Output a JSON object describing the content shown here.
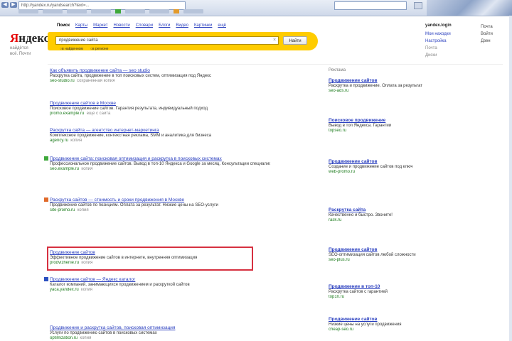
{
  "browser": {
    "url": "http://yandex.ru/yandsearch?text=...",
    "nav_back": "◀",
    "nav_fwd": "▶"
  },
  "logo": {
    "first_letter": "Я",
    "rest": "ндекс",
    "sub1": "найдётся",
    "sub2": "всё. Почти"
  },
  "tabs": [
    "Поиск",
    "Карты",
    "Маркет",
    "Новости",
    "Словари",
    "Блоги",
    "Видео",
    "Картинки",
    "ещё"
  ],
  "search": {
    "value": "продвижение сайта",
    "button_label": "Найти",
    "clear_icon": "×",
    "radios": [
      "в найденном",
      "в регионе"
    ]
  },
  "user": {
    "name": "yandex.login",
    "links": [
      "Мои находки",
      "Настройка",
      "Почта",
      "Диски"
    ]
  },
  "right_links": [
    "Почта",
    "Войти",
    "Дзен"
  ],
  "results": [
    {
      "title": "Как объявить продвижение сайта — seo studio",
      "snippet": "Раскрутка сайта, продвижение в топ поисковых систем, оптимизация под Яндекс",
      "url": "seo-studio.ru",
      "cache": "сохранённая копия"
    },
    {
      "title": "Продвижение сайтов в Москве",
      "snippet": "Поисковое продвижение сайтов. Гарантия результата, индивидуальный подход",
      "url": "promo.example.ru",
      "cache": "ещё с сайта"
    },
    {
      "title": "Раскрутка сайта — агентство интернет-маркетинга",
      "snippet": "Комплексное продвижение, контекстная реклама, SMM и аналитика для бизнеса",
      "url": "agency.ru",
      "cache": "копия"
    },
    {
      "title": "Продвижение сайта: поисковая оптимизация и раскрутка в поисковых системах",
      "snippet": "Профессиональное продвижение сайтов. Вывод в топ-10 Яндекса и Google за месяц. Консультации специалистов",
      "url": "seo.example.ru",
      "cache": "копия"
    },
    {
      "title": "Раскрутка сайтов — стоимость и сроки продвижения в Москве",
      "snippet": "Продвижение сайтов по позициям. Оплата за результат. Низкие цены на SEO-услуги",
      "url": "site-promo.ru",
      "cache": "копия"
    },
    {
      "title": "Продвижение сайтов",
      "snippet": "Эффективное продвижение сайтов в интернете, внутренняя оптимизация",
      "url": "prodvizhenie.ru",
      "cache": "копия"
    },
    {
      "title": "Продвижение сайтов — Яндекс каталог",
      "snippet": "Каталог компаний, занимающихся продвижением и раскруткой сайтов",
      "url": "yaca.yandex.ru",
      "cache": "копия"
    },
    {
      "title": "Продвижение и раскрутка сайтов, поисковая оптимизация",
      "snippet": "Услуги по продвижению сайтов в поисковых системах",
      "url": "optimization.ru",
      "cache": "копия"
    }
  ],
  "ads": {
    "header": "Реклама",
    "items": [
      {
        "title": "Продвижение сайтов",
        "snippet": "Раскрутка и продвижение. Оплата за результат",
        "url": "seo-ads.ru"
      },
      {
        "title": "Поисковое продвижение",
        "snippet": "Вывод в топ Яндекса. Гарантии",
        "url": "topseo.ru"
      },
      {
        "title": "Продвижение сайтов",
        "snippet": "Создание и продвижение сайтов под ключ",
        "url": "web-promo.ru"
      },
      {
        "title": "Раскрутка сайта",
        "snippet": "Качественно и быстро. Звоните!",
        "url": "rask.ru"
      },
      {
        "title": "Продвижение сайтов",
        "snippet": "SEO-оптимизация сайтов любой сложности",
        "url": "seo-plus.ru"
      },
      {
        "title": "Продвижение в топ-10",
        "snippet": "Раскрутка сайтов с гарантией",
        "url": "top10.ru"
      },
      {
        "title": "Продвижение сайтов",
        "snippet": "Низкие цены на услуги продвижения",
        "url": "cheap-seo.ru"
      }
    ]
  },
  "colors": {
    "accent": "#ffcc00",
    "link": "#2a3fbf",
    "url": "#1a7a1a",
    "highlight_box": "#d63040",
    "logo_red": "#e60000"
  }
}
